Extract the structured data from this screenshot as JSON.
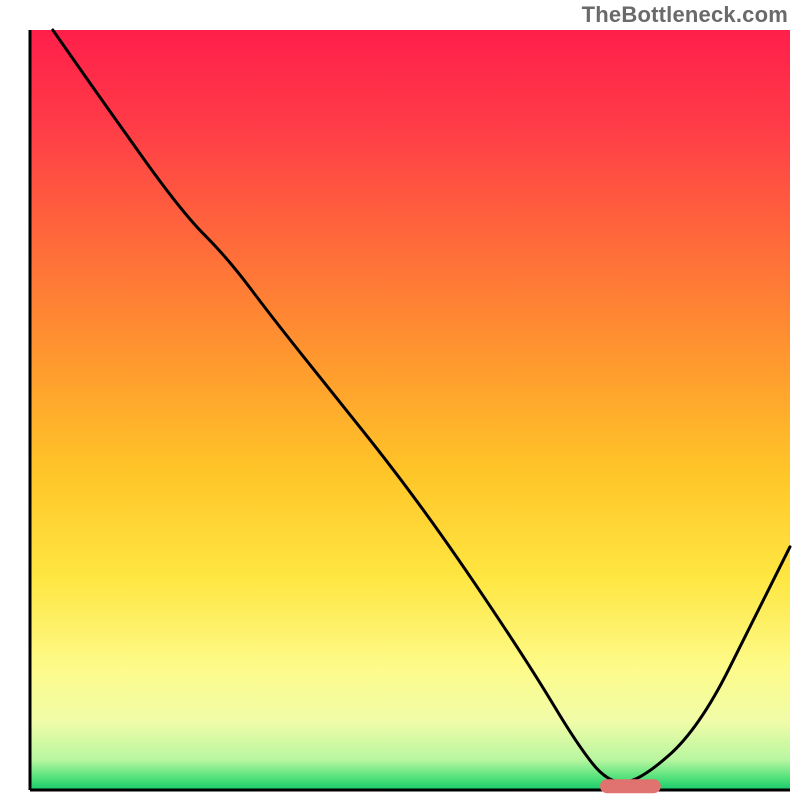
{
  "watermark": "TheBottleneck.com",
  "chart_data": {
    "type": "line",
    "title": "",
    "xlabel": "",
    "ylabel": "",
    "xlim": [
      0,
      100
    ],
    "ylim": [
      0,
      100
    ],
    "grid": false,
    "legend": false,
    "series": [
      {
        "name": "bottleneck-curve",
        "x": [
          3,
          10,
          20,
          26,
          32,
          40,
          48,
          56,
          66,
          72,
          76,
          80,
          88,
          96,
          100
        ],
        "values": [
          100,
          90,
          76,
          70,
          62,
          52,
          42,
          31,
          16,
          6,
          1,
          1,
          8,
          24,
          32
        ]
      }
    ],
    "markers": [
      {
        "name": "optimal-zone",
        "x_range": [
          75,
          83
        ],
        "y": 0.5
      }
    ],
    "gradient_stops": [
      {
        "offset": 0.0,
        "color": "#ff1f4a"
      },
      {
        "offset": 0.12,
        "color": "#ff3a48"
      },
      {
        "offset": 0.28,
        "color": "#ff6a3a"
      },
      {
        "offset": 0.44,
        "color": "#ff9a2e"
      },
      {
        "offset": 0.58,
        "color": "#ffc528"
      },
      {
        "offset": 0.72,
        "color": "#ffe641"
      },
      {
        "offset": 0.84,
        "color": "#fdfb8a"
      },
      {
        "offset": 0.91,
        "color": "#f0fca8"
      },
      {
        "offset": 0.96,
        "color": "#b9f6a0"
      },
      {
        "offset": 0.985,
        "color": "#4ee07a"
      },
      {
        "offset": 1.0,
        "color": "#17c96a"
      }
    ],
    "axis_color": "#000000",
    "marker_color": "#e0736f",
    "line_color": "#000000"
  }
}
